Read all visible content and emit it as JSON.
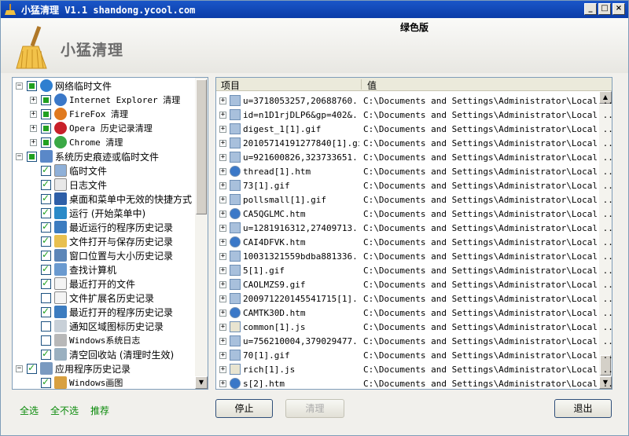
{
  "window": {
    "title": "小猛清理 V1.1 shandong.ycool.com"
  },
  "header": {
    "brand": "小猛清理",
    "edition": "绿色版"
  },
  "tree": [
    {
      "label": "网络临时文件",
      "level": 0,
      "state": "full",
      "icon": "globe-icon",
      "expander": "−"
    },
    {
      "label": "Internet Explorer 清理",
      "level": 1,
      "state": "full",
      "icon": "ie-icon",
      "expander": "+",
      "mono": true
    },
    {
      "label": "FireFox 清理",
      "level": 1,
      "state": "full",
      "icon": "firefox-icon",
      "expander": "+",
      "mono": true
    },
    {
      "label": "Opera 历史记录清理",
      "level": 1,
      "state": "full",
      "icon": "opera-icon",
      "expander": "+",
      "mono": true
    },
    {
      "label": "Chrome 清理",
      "level": 1,
      "state": "full",
      "icon": "chrome-icon",
      "expander": "+",
      "mono": true
    },
    {
      "label": "系统历史痕迹或临时文件",
      "level": 0,
      "state": "full",
      "icon": "windows-icon",
      "expander": "−"
    },
    {
      "label": "临时文件",
      "level": 2,
      "state": "check",
      "icon": "temp-file-icon"
    },
    {
      "label": "日志文件",
      "level": 2,
      "state": "check",
      "icon": "log-file-icon"
    },
    {
      "label": "桌面和菜单中无效的快捷方式",
      "level": 2,
      "state": "check",
      "icon": "desktop-icon"
    },
    {
      "label": "运行 (开始菜单中)",
      "level": 2,
      "state": "check",
      "icon": "run-icon"
    },
    {
      "label": "最近运行的程序历史记录",
      "level": 2,
      "state": "check",
      "icon": "program-icon"
    },
    {
      "label": "文件打开与保存历史记录",
      "level": 2,
      "state": "check",
      "icon": "folder-icon"
    },
    {
      "label": "窗口位置与大小历史记录",
      "level": 2,
      "state": "check",
      "icon": "window-icon"
    },
    {
      "label": "查找计算机",
      "level": 2,
      "state": "check",
      "icon": "search-computer-icon"
    },
    {
      "label": "最近打开的文件",
      "level": 2,
      "state": "check",
      "icon": "document-icon"
    },
    {
      "label": "文件扩展名历史记录",
      "level": 2,
      "state": "unchecked",
      "icon": "document-icon"
    },
    {
      "label": "最近打开的程序历史记录",
      "level": 2,
      "state": "check",
      "icon": "program-icon"
    },
    {
      "label": "通知区域图标历史记录",
      "level": 2,
      "state": "unchecked",
      "icon": "tray-icon"
    },
    {
      "label": "Windows系统日志",
      "level": 2,
      "state": "unchecked",
      "icon": "syslog-icon",
      "mono": true
    },
    {
      "label": "清空回收站 (清理时生效)",
      "level": 2,
      "state": "check",
      "icon": "recycle-bin-icon"
    },
    {
      "label": "应用程序历史记录",
      "level": 0,
      "state": "check",
      "icon": "apps-icon",
      "expander": "−"
    },
    {
      "label": "Windows画图",
      "level": 2,
      "state": "check",
      "icon": "paint-icon",
      "mono": true
    }
  ],
  "list": {
    "col_item": "项目",
    "col_value": "值",
    "rows": [
      {
        "name": "u=3718053257,20688760...",
        "value": "C:\\Documents and Settings\\Administrator\\Local ...",
        "icon": "image-icon"
      },
      {
        "name": "id=n1D1rjDLP6&gp=402&...",
        "value": "C:\\Documents and Settings\\Administrator\\Local ...",
        "icon": "image-icon"
      },
      {
        "name": "digest_1[1].gif",
        "value": "C:\\Documents and Settings\\Administrator\\Local ...",
        "icon": "image-icon"
      },
      {
        "name": "20105714191277840[1].gif",
        "value": "C:\\Documents and Settings\\Administrator\\Local ...",
        "icon": "image-icon"
      },
      {
        "name": "u=921600826,323733651...",
        "value": "C:\\Documents and Settings\\Administrator\\Local ...",
        "icon": "image-icon"
      },
      {
        "name": "thread[1].htm",
        "value": "C:\\Documents and Settings\\Administrator\\Local ...",
        "icon": "html-icon"
      },
      {
        "name": "73[1].gif",
        "value": "C:\\Documents and Settings\\Administrator\\Local ...",
        "icon": "image-icon"
      },
      {
        "name": "pollsmall[1].gif",
        "value": "C:\\Documents and Settings\\Administrator\\Local ...",
        "icon": "image-icon"
      },
      {
        "name": "CA5QGLMC.htm",
        "value": "C:\\Documents and Settings\\Administrator\\Local ...",
        "icon": "html-icon"
      },
      {
        "name": "u=1281916312,27409713...",
        "value": "C:\\Documents and Settings\\Administrator\\Local ...",
        "icon": "image-icon"
      },
      {
        "name": "CAI4DFVK.htm",
        "value": "C:\\Documents and Settings\\Administrator\\Local ...",
        "icon": "html-icon"
      },
      {
        "name": "10031321559bdba881336...",
        "value": "C:\\Documents and Settings\\Administrator\\Local ...",
        "icon": "image-icon"
      },
      {
        "name": "5[1].gif",
        "value": "C:\\Documents and Settings\\Administrator\\Local ...",
        "icon": "image-icon"
      },
      {
        "name": "CAOLMZS9.gif",
        "value": "C:\\Documents and Settings\\Administrator\\Local ...",
        "icon": "image-icon"
      },
      {
        "name": "200971220145541715[1]...",
        "value": "C:\\Documents and Settings\\Administrator\\Local ...",
        "icon": "image-icon"
      },
      {
        "name": "CAMTK30D.htm",
        "value": "C:\\Documents and Settings\\Administrator\\Local ...",
        "icon": "html-icon"
      },
      {
        "name": "common[1].js",
        "value": "C:\\Documents and Settings\\Administrator\\Local ...",
        "icon": "script-icon"
      },
      {
        "name": "u=756210004,379029477...",
        "value": "C:\\Documents and Settings\\Administrator\\Local ...",
        "icon": "image-icon"
      },
      {
        "name": "70[1].gif",
        "value": "C:\\Documents and Settings\\Administrator\\Local ...",
        "icon": "image-icon"
      },
      {
        "name": "rich[1].js",
        "value": "C:\\Documents and Settings\\Administrator\\Local ...",
        "icon": "script-icon"
      },
      {
        "name": "s[2].htm",
        "value": "C:\\Documents and Settings\\Administrator\\Local ...",
        "icon": "html-icon"
      }
    ]
  },
  "footer": {
    "select_all": "全选",
    "select_none": "全不选",
    "recommend": "推荐",
    "stop": "停止",
    "clean": "清理",
    "exit": "退出"
  },
  "colors": {
    "accent_green": "#21a121",
    "titlebar": "#0b3da8",
    "link_green": "#0a8a0a"
  }
}
